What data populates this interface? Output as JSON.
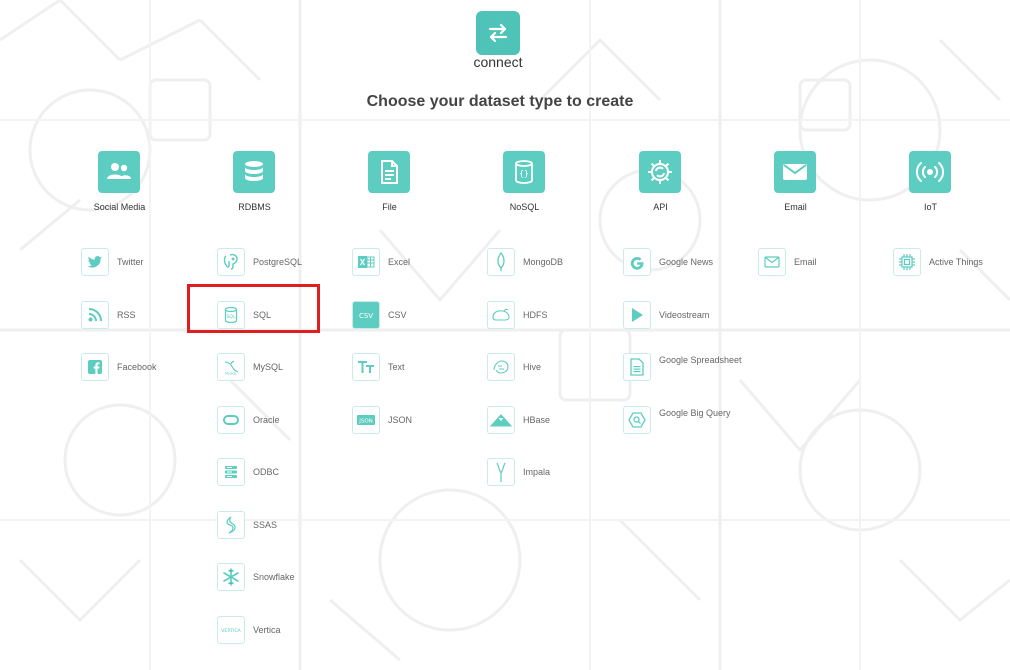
{
  "header": {
    "logo_text": "connect",
    "title": "Choose your dataset type to create"
  },
  "colors": {
    "accent": "#5ccdc0",
    "accent_dark": "#4fc3b7",
    "highlight": "#e01e1e"
  },
  "columns": [
    {
      "category": "Social Media",
      "category_icon": "users-icon",
      "items": [
        {
          "label": "Twitter",
          "icon": "twitter-icon"
        },
        {
          "label": "RSS",
          "icon": "rss-icon"
        },
        {
          "label": "Facebook",
          "icon": "facebook-icon"
        }
      ]
    },
    {
      "category": "RDBMS",
      "category_icon": "database-icon",
      "items": [
        {
          "label": "PostgreSQL",
          "icon": "postgresql-icon"
        },
        {
          "label": "SQL",
          "icon": "sql-icon",
          "highlighted": true
        },
        {
          "label": "MySQL",
          "icon": "mysql-icon"
        },
        {
          "label": "Oracle",
          "icon": "oracle-icon"
        },
        {
          "label": "ODBC",
          "icon": "odbc-icon"
        },
        {
          "label": "SSAS",
          "icon": "ssas-icon"
        },
        {
          "label": "Snowflake",
          "icon": "snowflake-icon"
        },
        {
          "label": "Vertica",
          "icon": "vertica-icon"
        }
      ]
    },
    {
      "category": "File",
      "category_icon": "file-icon",
      "items": [
        {
          "label": "Excel",
          "icon": "excel-icon"
        },
        {
          "label": "CSV",
          "icon": "csv-icon"
        },
        {
          "label": "Text",
          "icon": "text-icon"
        },
        {
          "label": "JSON",
          "icon": "json-icon"
        }
      ]
    },
    {
      "category": "NoSQL",
      "category_icon": "nosql-icon",
      "items": [
        {
          "label": "MongoDB",
          "icon": "mongodb-icon"
        },
        {
          "label": "HDFS",
          "icon": "hdfs-icon"
        },
        {
          "label": "Hive",
          "icon": "hive-icon"
        },
        {
          "label": "HBase",
          "icon": "hbase-icon"
        },
        {
          "label": "Impala",
          "icon": "impala-icon"
        }
      ]
    },
    {
      "category": "API",
      "category_icon": "api-gear-icon",
      "items": [
        {
          "label": "Google News",
          "icon": "google-news-icon"
        },
        {
          "label": "Videostream",
          "icon": "play-icon"
        },
        {
          "label": "Google Spreadsheet",
          "icon": "spreadsheet-icon"
        },
        {
          "label": "Google Big Query",
          "icon": "bigquery-icon"
        }
      ]
    },
    {
      "category": "Email",
      "category_icon": "mail-icon",
      "items": [
        {
          "label": "Email",
          "icon": "mail-icon"
        }
      ]
    },
    {
      "category": "IoT",
      "category_icon": "iot-broadcast-icon",
      "items": [
        {
          "label": "Active Things",
          "icon": "chip-icon"
        }
      ]
    }
  ]
}
